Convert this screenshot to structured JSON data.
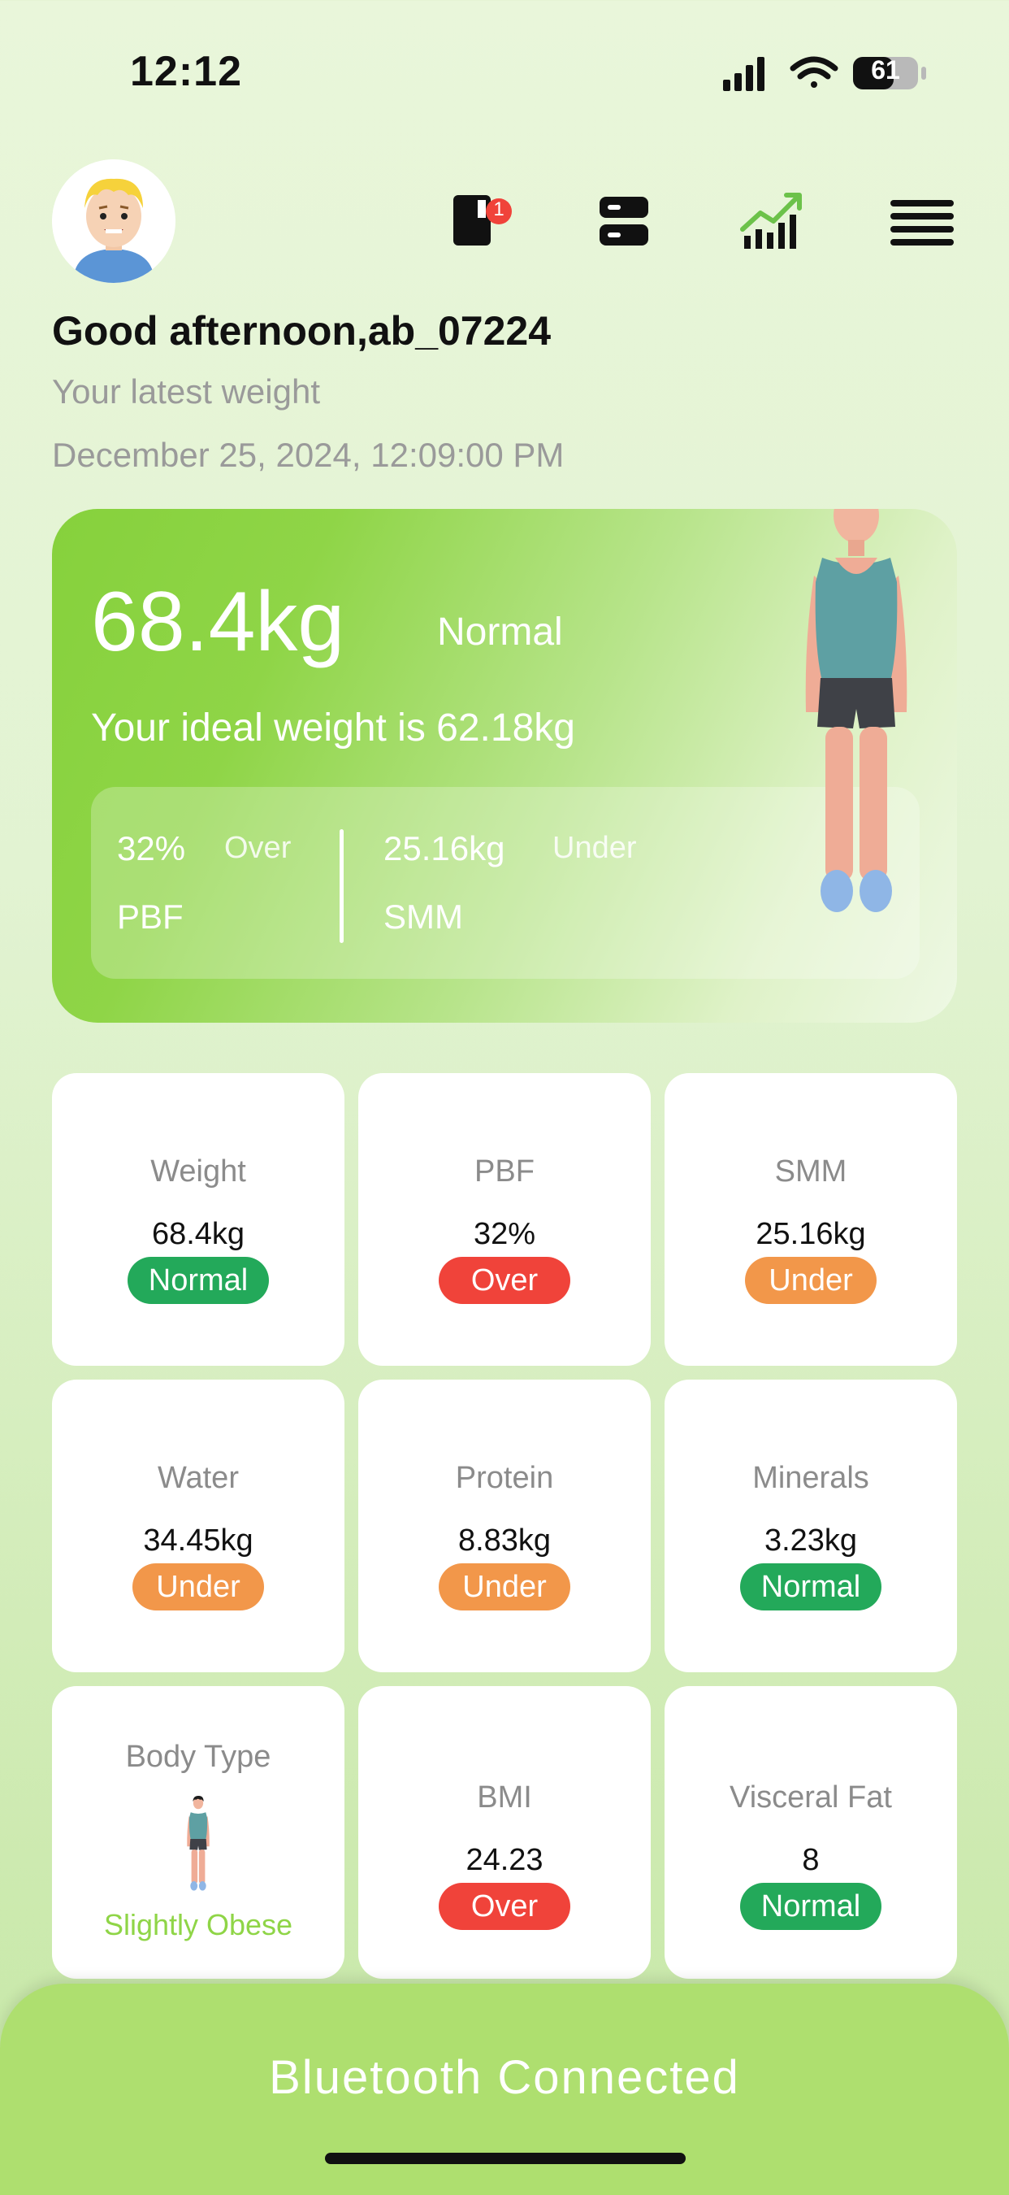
{
  "status_bar": {
    "time": "12:12",
    "battery": "61"
  },
  "header": {
    "notification_count": "1",
    "greeting": "Good afternoon,ab_07224",
    "latest_label": "Your latest weight",
    "datetime": "December 25, 2024, 12:09:00 PM"
  },
  "hero": {
    "weight": "68.4kg",
    "status": "Normal",
    "ideal": "Your ideal weight is 62.18kg",
    "pbf_value": "32%",
    "pbf_state": "Over",
    "pbf_label": "PBF",
    "smm_value": "25.16kg",
    "smm_state": "Under",
    "smm_label": "SMM"
  },
  "metrics": [
    {
      "label": "Weight",
      "value": "68.4kg",
      "status": "Normal",
      "color": "#23a95a"
    },
    {
      "label": "PBF",
      "value": "32%",
      "status": "Over",
      "color": "#f0433a"
    },
    {
      "label": "SMM",
      "value": "25.16kg",
      "status": "Under",
      "color": "#f2974a"
    },
    {
      "label": "Water",
      "value": "34.45kg",
      "status": "Under",
      "color": "#f2974a"
    },
    {
      "label": "Protein",
      "value": "8.83kg",
      "status": "Under",
      "color": "#f2974a"
    },
    {
      "label": "Minerals",
      "value": "3.23kg",
      "status": "Normal",
      "color": "#23a95a"
    },
    {
      "label": "BMI",
      "value": "24.23",
      "status": "Over",
      "color": "#f0433a"
    },
    {
      "label": "Visceral Fat",
      "value": "8",
      "status": "Normal",
      "color": "#23a95a"
    }
  ],
  "body_type": {
    "label": "Body Type",
    "value": "Slightly Obese",
    "color": "#8fd547"
  },
  "bottom": {
    "bluetooth": "Bluetooth Connected"
  },
  "colors": {
    "accent": "#8fd547",
    "normal": "#23a95a",
    "over": "#f0433a",
    "under": "#f2974a"
  }
}
